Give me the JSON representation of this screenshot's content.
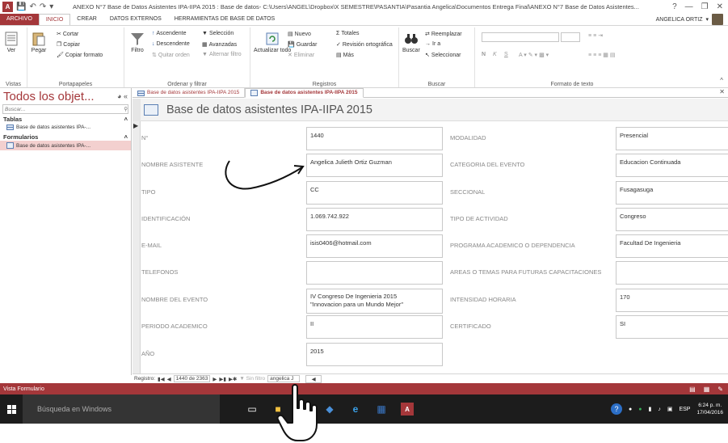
{
  "window": {
    "title": "ANEXO N°7 Base de Datos Asistentes IPA-IIPA 2015 : Base de datos- C:\\Users\\ANGEL\\Dropbox\\X SEMESTRE\\PASANTIA\\Pasantia Angelica\\Documentos Entrega Final\\ANEXO N°7 Base de Datos Asistentes...",
    "app_icon": "A",
    "help": "?"
  },
  "ribbon_tabs": {
    "file": "ARCHIVO",
    "home": "INICIO",
    "create": "CREAR",
    "external": "DATOS EXTERNOS",
    "tools": "HERRAMIENTAS DE BASE DE DATOS",
    "user": "ANGELICA ORTIZ"
  },
  "ribbon": {
    "views": {
      "label": "Vistas",
      "ver": "Ver"
    },
    "clipboard": {
      "label": "Portapapeles",
      "paste": "Pegar",
      "cut": "Cortar",
      "copy": "Copiar",
      "format_painter": "Copiar formato"
    },
    "sort_filter": {
      "label": "Ordenar y filtrar",
      "filter": "Filtro",
      "ascending": "Ascendente",
      "descending": "Descendente",
      "remove_sort": "Quitar orden",
      "selection": "Selección",
      "advanced": "Avanzadas",
      "toggle_filter": "Alternar filtro"
    },
    "records": {
      "label": "Registros",
      "refresh": "Actualizar todo",
      "new": "Nuevo",
      "save": "Guardar",
      "delete": "Eliminar",
      "totals": "Totales",
      "spelling": "Revisión ortográfica",
      "more": "Más"
    },
    "find": {
      "label": "Buscar",
      "find": "Buscar",
      "replace": "Reemplazar",
      "goto": "Ir a",
      "select": "Seleccionar"
    },
    "text_format": {
      "label": "Formato de texto",
      "bold": "N",
      "italic": "K",
      "underline": "S"
    }
  },
  "nav": {
    "title": "Todos los objet...",
    "search_placeholder": "Buscar...",
    "tables_header": "Tablas",
    "table_item": "Base de datos asistentes IPA-...",
    "forms_header": "Formularios",
    "form_item": "Base de datos asistentes IPA-..."
  },
  "doc_tabs": {
    "table_tab": "Base de datos asistentes IPA-IIPA 2015",
    "form_tab": "Base de datos asistentes IPA-IIPA 2015"
  },
  "form": {
    "title": "Base de datos asistentes IPA-IIPA 2015",
    "fields": {
      "numero": {
        "label": "N°",
        "value": "1440"
      },
      "nombre": {
        "label": "NOMBRE ASISTENTE",
        "value": "Angelica Julieth Ortiz Guzman"
      },
      "tipo": {
        "label": "TIPO",
        "value": "CC"
      },
      "identificacion": {
        "label": "IDENTIFICACIÓN",
        "value": "1.069.742.922"
      },
      "email": {
        "label": "E-MAIL",
        "value": "isis0406@hotmail.com"
      },
      "telefonos": {
        "label": "TELEFONOS",
        "value": ""
      },
      "evento": {
        "label": "NOMBRE DEL EVENTO",
        "value_line1": "IV Congreso De Ingenieria 2015",
        "value_line2": "\"Innovacion para un Mundo Mejor\""
      },
      "periodo": {
        "label": "PERIODO ACADEMICO",
        "value": "II"
      },
      "anio": {
        "label": "AÑO",
        "value": "2015"
      },
      "modalidad": {
        "label": "MODALIDAD",
        "value": "Presencial"
      },
      "categoria": {
        "label": "CATEGORIA DEL EVENTO",
        "value": "Educacion Continuada"
      },
      "seccional": {
        "label": "SECCIONAL",
        "value": "Fusagasuga"
      },
      "tipo_actividad": {
        "label": "TIPO DE ACTIVIDAD",
        "value": "Congreso"
      },
      "programa": {
        "label": "PROGRAMA ACADEMICO O DEPENDENCIA",
        "value": "Facultad De Ingenieria"
      },
      "areas": {
        "label": "AREAS O TEMAS PARA FUTURAS CAPACITACIONES",
        "value": ""
      },
      "intensidad": {
        "label": "INTENSIDAD HORARIA",
        "value": "170"
      },
      "certificado": {
        "label": "CERTIFICADO",
        "value": "SI"
      }
    }
  },
  "record_nav": {
    "label": "Registro:",
    "position": "1440 de 2363",
    "filter": "Sin filtro",
    "search": "angelica J"
  },
  "status": {
    "text": "Vista Formulario"
  },
  "taskbar": {
    "search": "Búsqueda en Windows",
    "lang": "ESP",
    "time": "6:24 p. m.",
    "date": "17/04/2016"
  }
}
